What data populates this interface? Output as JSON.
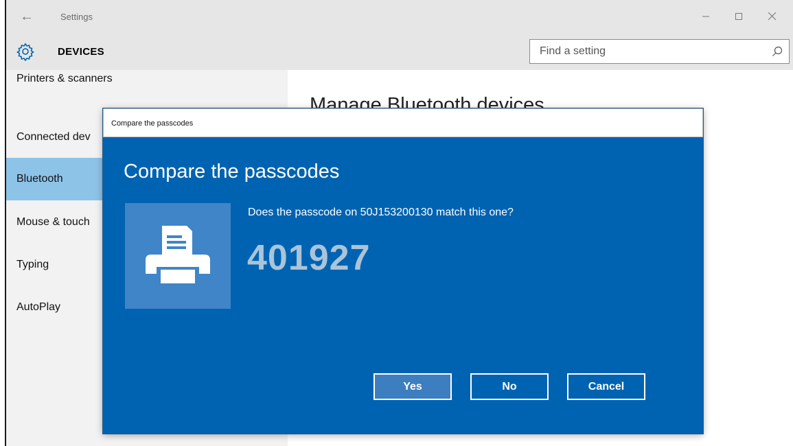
{
  "window": {
    "title": "Settings",
    "controls": [
      "minimize-icon",
      "maximize-icon",
      "close-icon"
    ]
  },
  "header": {
    "icon": "gear-icon",
    "section": "DEVICES",
    "search_placeholder": "Find a setting",
    "search_icon": "search-icon"
  },
  "sidebar": {
    "items": [
      {
        "label": "Printers & scanners",
        "active": false
      },
      {
        "label": "Connected dev",
        "active": false
      },
      {
        "label": "Bluetooth",
        "active": true
      },
      {
        "label": "Mouse & touch",
        "active": false
      },
      {
        "label": "Typing",
        "active": false
      },
      {
        "label": "AutoPlay",
        "active": false
      }
    ]
  },
  "content": {
    "title": "Manage Bluetooth devices"
  },
  "dialog": {
    "window_title": "Compare the passcodes",
    "heading": "Compare the passcodes",
    "device_icon": "printer-icon",
    "question": "Does the passcode on 50J153200130 match this one?",
    "passcode": "401927",
    "buttons": {
      "yes": "Yes",
      "no": "No",
      "cancel": "Cancel"
    }
  },
  "colors": {
    "dialog_background": "#0063b1",
    "device_tile": "#3f85c8",
    "passcode_text": "#aac4d9",
    "sidebar_active": "#8ec3e8",
    "chrome": "#e6e6e6"
  }
}
